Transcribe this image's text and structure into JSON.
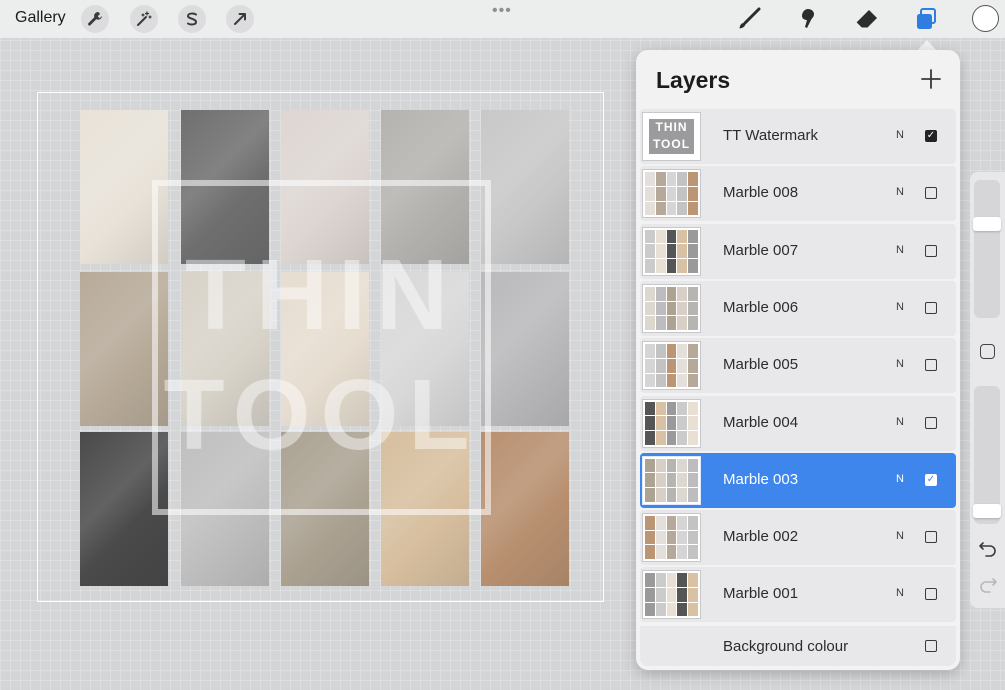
{
  "topbar": {
    "gallery_label": "Gallery",
    "left_tools": [
      "wrench-icon",
      "magic-wand-icon",
      "selection-s-icon",
      "transform-arrow-icon"
    ],
    "right_tools": [
      "brush-icon",
      "smudge-icon",
      "eraser-icon",
      "layers-icon"
    ],
    "color_well": "#ffffff",
    "active_tool_color": "#2f7de1"
  },
  "canvas": {
    "watermark_text_line1": "THIN",
    "watermark_text_line2": "TOOL",
    "tile_colors": [
      [
        "#e8e2d8",
        "#6f6f6f",
        "#ddd6d2",
        "#b5b3b0",
        "#c8c8c8"
      ],
      [
        "#b7aa99",
        "#d8d3c9",
        "#e6ddd0",
        "#d8d8d8",
        "#b9b9bb"
      ],
      [
        "#4a4a4a",
        "#bfbfbf",
        "#aba292",
        "#d7bf9f",
        "#b89070"
      ]
    ]
  },
  "layers_panel": {
    "title": "Layers",
    "add_button": "+",
    "layers": [
      {
        "name": "TT Watermark",
        "blend": "N",
        "visible": true,
        "selected": false,
        "thumb_text1": "THIN",
        "thumb_text2": "TOOL"
      },
      {
        "name": "Marble 008",
        "blend": "N",
        "visible": false,
        "selected": false
      },
      {
        "name": "Marble 007",
        "blend": "N",
        "visible": false,
        "selected": false
      },
      {
        "name": "Marble 006",
        "blend": "N",
        "visible": false,
        "selected": false
      },
      {
        "name": "Marble 005",
        "blend": "N",
        "visible": false,
        "selected": false
      },
      {
        "name": "Marble 004",
        "blend": "N",
        "visible": false,
        "selected": false
      },
      {
        "name": "Marble 003",
        "blend": "N",
        "visible": true,
        "selected": true
      },
      {
        "name": "Marble 002",
        "blend": "N",
        "visible": false,
        "selected": false
      },
      {
        "name": "Marble 001",
        "blend": "N",
        "visible": false,
        "selected": false
      }
    ],
    "background": {
      "name": "Background colour",
      "visible": false
    },
    "selection_color": "#3e86ec"
  },
  "sidebar": {
    "brush_size_level": 0.7,
    "opacity_level": 0.05
  }
}
